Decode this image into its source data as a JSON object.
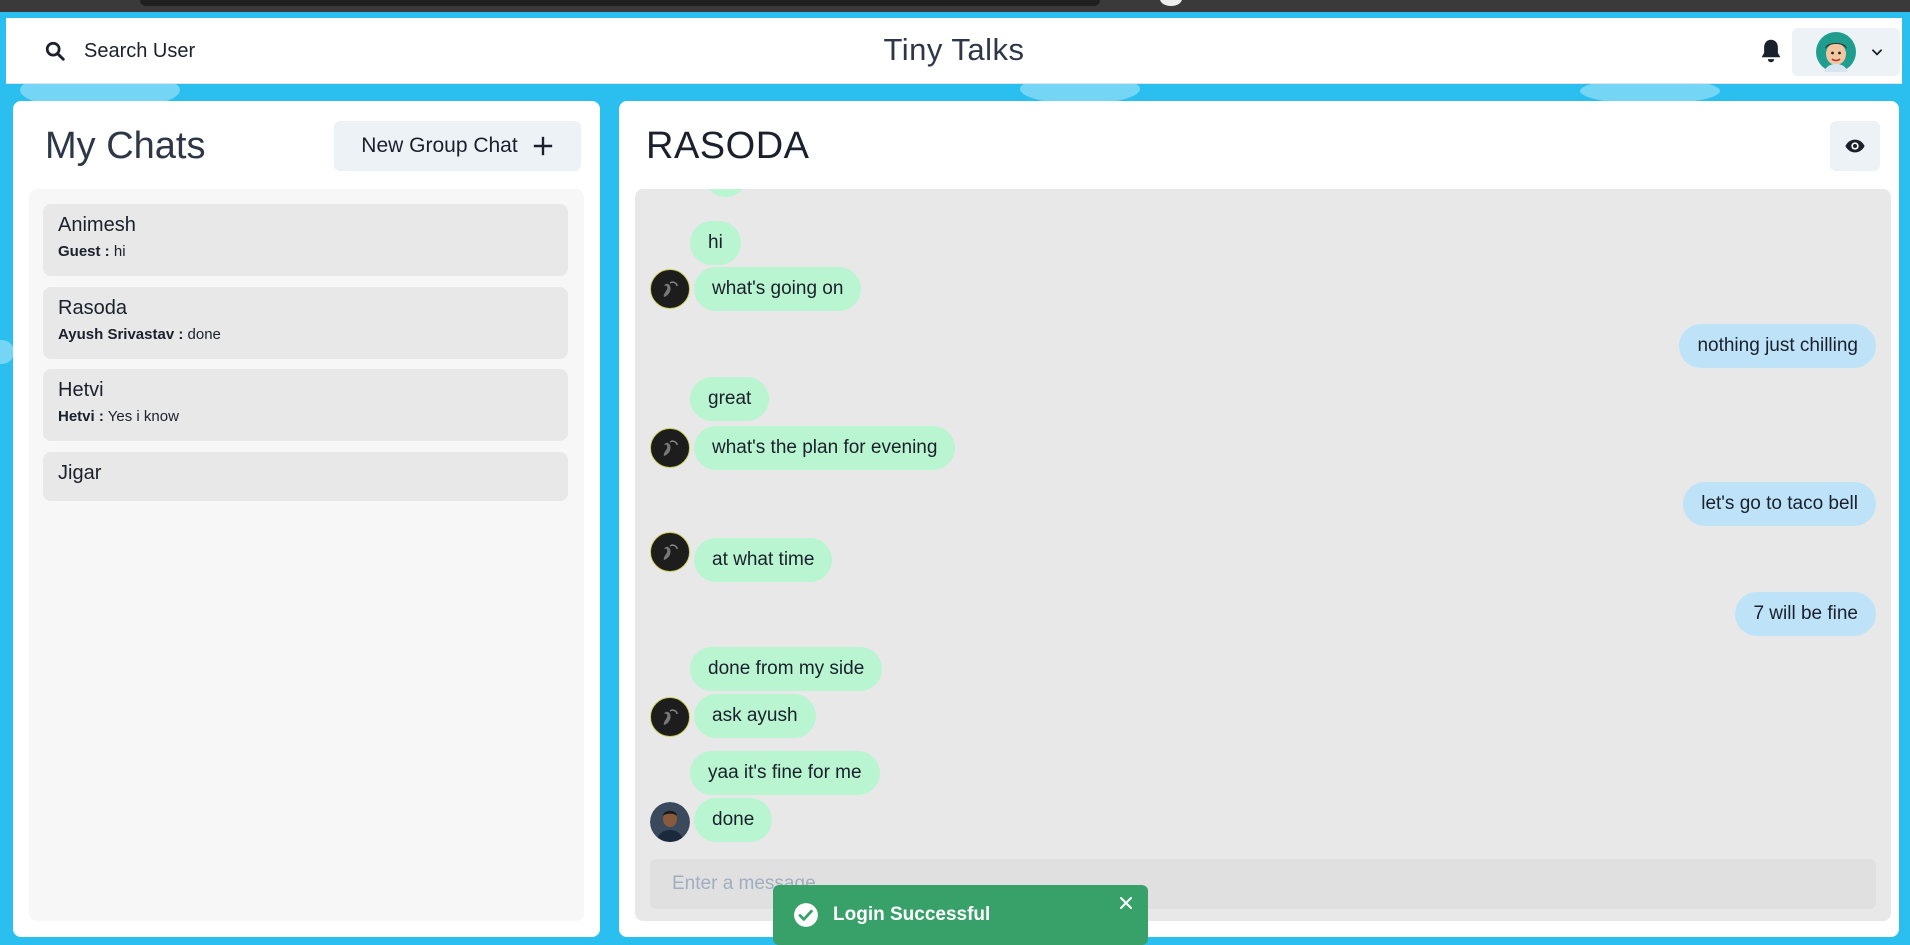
{
  "header": {
    "search_label": "Search User",
    "app_title": "Tiny Talks",
    "icons": {
      "search": "search-icon",
      "bell": "bell-icon",
      "chevron": "chevron-down-icon"
    }
  },
  "sidebar": {
    "title": "My Chats",
    "new_group_label": "New Group Chat",
    "chats": [
      {
        "name": "Animesh",
        "sender": "Guest :",
        "message": "hi"
      },
      {
        "name": "Rasoda",
        "sender": "Ayush Srivastav :",
        "message": "done"
      },
      {
        "name": "Hetvi",
        "sender": "Hetvi :",
        "message": "Yes i know"
      },
      {
        "name": "Jigar",
        "sender": "",
        "message": ""
      }
    ]
  },
  "chat": {
    "title": "RASODA",
    "messages": [
      {
        "text": "hi",
        "side": "other"
      },
      {
        "text": "what's going on",
        "side": "other"
      },
      {
        "text": "nothing just chilling",
        "side": "me"
      },
      {
        "text": "great",
        "side": "other"
      },
      {
        "text": "what's the plan for evening",
        "side": "other"
      },
      {
        "text": "let's go to taco bell",
        "side": "me"
      },
      {
        "text": "at what time",
        "side": "other"
      },
      {
        "text": "7 will be fine",
        "side": "me"
      },
      {
        "text": "done from my side",
        "side": "other"
      },
      {
        "text": "ask ayush",
        "side": "other"
      },
      {
        "text": "yaa it's fine for me",
        "side": "other"
      },
      {
        "text": "done",
        "side": "other"
      }
    ],
    "input_placeholder": "Enter a message.."
  },
  "toast": {
    "text": "Login Successful",
    "color": "#38a169"
  },
  "colors": {
    "other_bubble": "#b9f5d0",
    "my_bubble": "#bee3f8",
    "background": "#2bbff0"
  }
}
